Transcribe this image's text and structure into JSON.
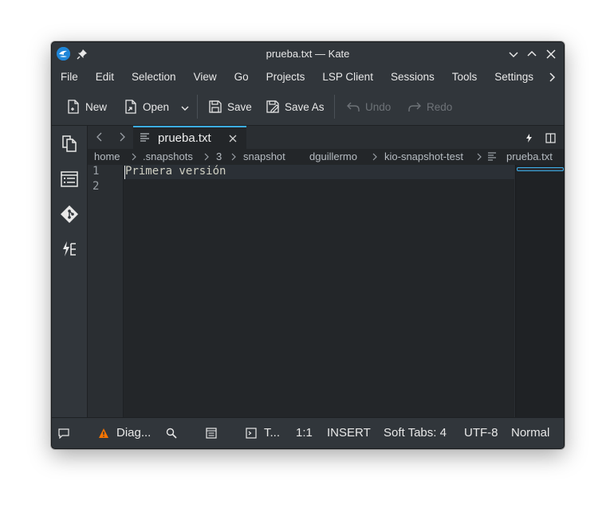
{
  "window": {
    "title": "prueba.txt — Kate"
  },
  "menu": {
    "items": [
      "File",
      "Edit",
      "Selection",
      "View",
      "Go",
      "Projects",
      "LSP Client",
      "Sessions",
      "Tools",
      "Settings"
    ]
  },
  "toolbar": {
    "new_label": "New",
    "open_label": "Open",
    "save_label": "Save",
    "save_as_label": "Save As",
    "undo_label": "Undo",
    "redo_label": "Redo"
  },
  "tabs": [
    {
      "label": "prueba.txt",
      "active": true
    }
  ],
  "breadcrumb": {
    "items": [
      "home",
      ".snapshots",
      "3",
      "snapshot",
      "dguillermo",
      "kio-snapshot-test",
      "prueba.txt"
    ]
  },
  "editor": {
    "line_numbers": [
      "1",
      "2"
    ],
    "lines": [
      "Primera versión",
      ""
    ]
  },
  "statusbar": {
    "diagnostics_label": "Diag...",
    "terminal_label": "T...",
    "cursor_position": "1:1",
    "input_mode": "INSERT",
    "indentation": "Soft Tabs: 4",
    "encoding": "UTF-8",
    "mode": "Normal"
  },
  "colors": {
    "accent": "#3daee9",
    "window_bg": "#2a2e32",
    "chrome_bg": "#31363b",
    "editor_bg": "#232629",
    "warning": "#f67400"
  }
}
